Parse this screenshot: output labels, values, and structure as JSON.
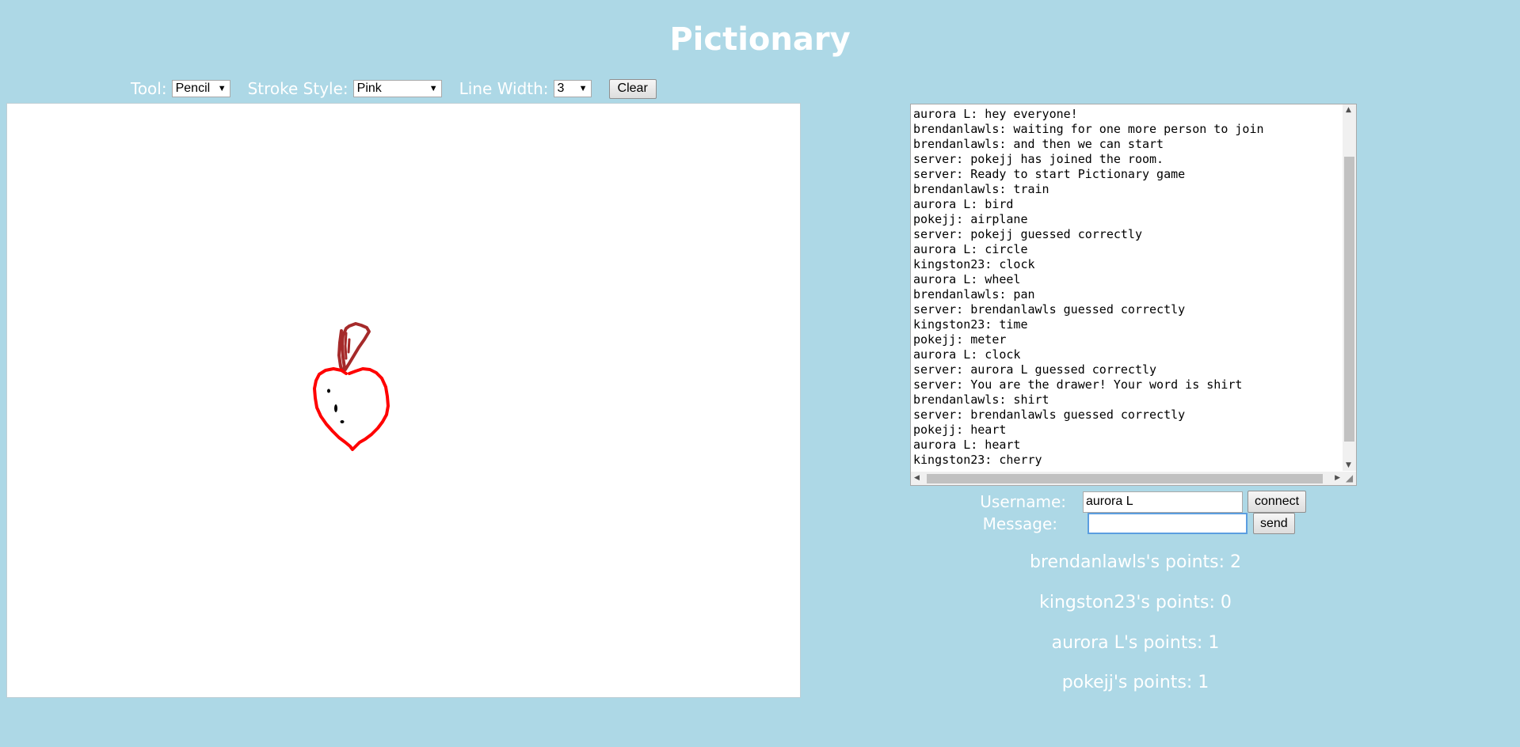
{
  "page": {
    "title": "Pictionary"
  },
  "toolbar": {
    "tool_label": "Tool:",
    "tool_value": "Pencil",
    "stroke_label": "Stroke Style:",
    "stroke_value": "Pink",
    "width_label": "Line Width:",
    "width_value": "3",
    "clear_label": "Clear",
    "dropdown_arrow": "▼"
  },
  "drawing": {
    "heart_color": "#ff0000",
    "stem_color": "#a52a2a",
    "dots_color": "#000000"
  },
  "chat": {
    "lines": [
      "aurora L: hey everyone!",
      "brendanlawls: waiting for one more person to join",
      "brendanlawls: and then we can start",
      "server: pokejj has joined the room.",
      "server: Ready to start Pictionary game",
      "brendanlawls: train",
      "aurora L: bird",
      "pokejj: airplane",
      "server: pokejj guessed correctly",
      "aurora L: circle",
      "kingston23: clock",
      "aurora L: wheel",
      "brendanlawls: pan",
      "server: brendanlawls guessed correctly",
      "kingston23: time",
      "pokejj: meter",
      "aurora L: clock",
      "server: aurora L guessed correctly",
      "server: You are the drawer! Your word is shirt",
      "brendanlawls: shirt",
      "server: brendanlawls guessed correctly",
      "pokejj: heart",
      "aurora L: heart",
      "kingston23: cherry"
    ]
  },
  "form": {
    "username_label": "Username:",
    "username_value": "aurora L",
    "connect_label": "connect",
    "message_label": "Message:",
    "message_value": "",
    "send_label": "send"
  },
  "scores": [
    "brendanlawls's points: 2",
    "kingston23's points: 0",
    "aurora L's points: 1",
    "pokejj's points: 1"
  ]
}
